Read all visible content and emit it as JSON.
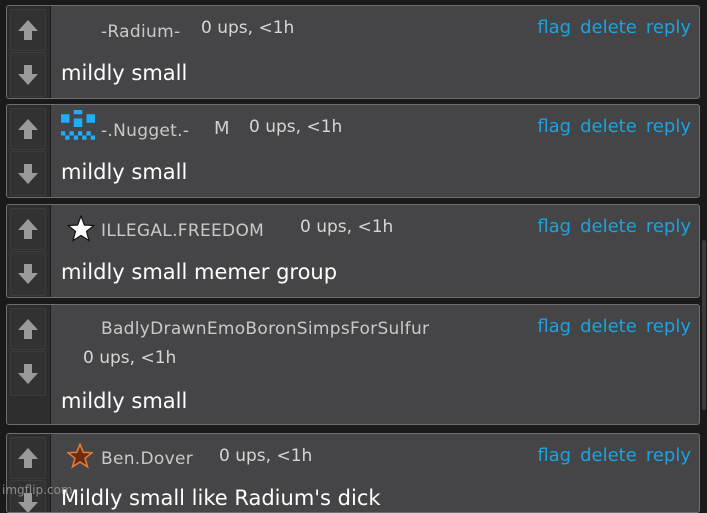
{
  "colors": {
    "background": "#1a1a1b",
    "comment_bg": "#454547",
    "vote_bg": "#2d2d2e",
    "action_link": "#1aa3e0",
    "username": "#c9c9c9",
    "comment_text": "#ffffff"
  },
  "actions": {
    "flag": "flag",
    "delete": "delete",
    "reply": "reply"
  },
  "comments": [
    {
      "username": "-Radium-",
      "avatar": "none",
      "badge": "",
      "meta": "0 ups, <1h",
      "text": "mildly small"
    },
    {
      "username": "-.Nugget.-",
      "avatar": "blue-pixel-face-icon",
      "badge": "M",
      "meta": "0 ups, <1h",
      "text": "mildly small"
    },
    {
      "username": "ILLEGAL.FREEDOM",
      "avatar": "white-star-icon",
      "badge": "",
      "meta": "0 ups, <1h",
      "text": "mildly small memer group"
    },
    {
      "username": "BadlyDrawnEmoBoronSimpsForSulfur",
      "avatar": "none",
      "badge": "",
      "meta": "0 ups, <1h",
      "text": "mildly small"
    },
    {
      "username": "Ben.Dover",
      "avatar": "orange-star-icon",
      "badge": "",
      "meta": "0 ups, <1h",
      "text": "Mildly small like Radium's dick"
    }
  ],
  "watermark": "imgflip.com"
}
